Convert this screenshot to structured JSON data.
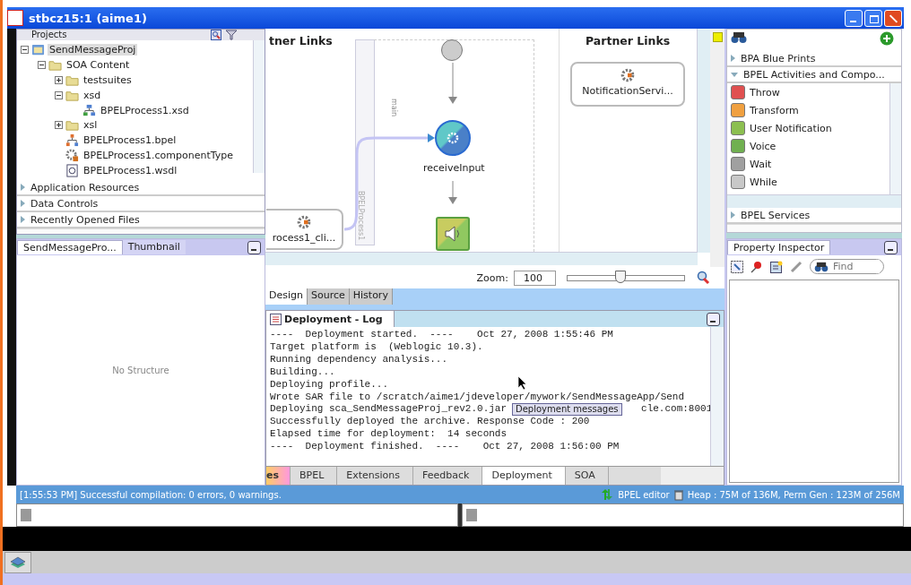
{
  "window": {
    "title": "stbcz15:1 (aime1)"
  },
  "projects": {
    "title": "Projects",
    "tree": [
      {
        "label": "SendMessageProj",
        "kind": "project",
        "selected": true,
        "expanded": true,
        "children": [
          {
            "label": "SOA Content",
            "kind": "folder",
            "selected": false,
            "expanded": true,
            "children": [
              {
                "label": "testsuites",
                "kind": "folder",
                "selected": false,
                "expanded": false
              },
              {
                "label": "xsd",
                "kind": "folder",
                "selected": false,
                "expanded": true,
                "children": [
                  {
                    "label": "BPELProcess1.xsd",
                    "kind": "schema",
                    "selected": false
                  }
                ]
              },
              {
                "label": "xsl",
                "kind": "folder",
                "selected": false,
                "expanded": false
              },
              {
                "label": "BPELProcess1.bpel",
                "kind": "bpel",
                "selected": false
              },
              {
                "label": "BPELProcess1.componentType",
                "kind": "component",
                "selected": false
              },
              {
                "label": "BPELProcess1.wsdl",
                "kind": "wsdl",
                "selected": false
              }
            ]
          }
        ]
      }
    ]
  },
  "navigator_sections": [
    {
      "label": "Application Resources",
      "expanded": false
    },
    {
      "label": "Data Controls",
      "expanded": false
    },
    {
      "label": "Recently Opened Files",
      "expanded": false
    }
  ],
  "structure": {
    "tabs": [
      {
        "label": "SendMessagePro...",
        "selected": true
      },
      {
        "label": "Thumbnail",
        "selected": false
      }
    ],
    "empty_text": "No Structure"
  },
  "canvas": {
    "left_heading": "tner Links",
    "right_heading": "Partner Links",
    "scope_label": "main",
    "process_label": "BPELProcess1",
    "left_partner": "rocess1_cli...",
    "right_partner": "NotificationServi...",
    "activities": [
      {
        "kind": "receive",
        "label": "receiveInput"
      },
      {
        "kind": "notification"
      }
    ]
  },
  "zoom": {
    "label": "Zoom:",
    "value": "100",
    "level": 0.45
  },
  "editor_tabs": [
    {
      "label": "Design",
      "selected": true
    },
    {
      "label": "Source",
      "selected": false
    },
    {
      "label": "History",
      "selected": false
    }
  ],
  "log": {
    "title": "Deployment - Log",
    "lines": [
      {
        "text": "----  Deployment started.  ----    Oct 27, 2008 1:55:46 PM"
      },
      {
        "text": "Target platform is  (Weblogic 10.3)."
      },
      {
        "text": "Running dependency analysis..."
      },
      {
        "text": "Building..."
      },
      {
        "text": "Deploying profile..."
      },
      {
        "text": "Wrote SAR file to /scratch/aime1/jdeveloper/mywork/SendMessageApp/Send"
      },
      {
        "text": "Deploying sca_SendMessageProj_rev2.0.jar",
        "tail": "cle.com:8001"
      },
      {
        "text": "Successfully deployed the archive. Response Code : 200"
      },
      {
        "text": "Elapsed time for deployment:  14 seconds"
      },
      {
        "text": "----  Deployment finished.  ----    Oct 27, 2008 1:56:00 PM"
      }
    ],
    "tooltip": "Deployment messages",
    "tabs": [
      {
        "label": "es",
        "selected": false
      },
      {
        "label": "BPEL",
        "selected": false
      },
      {
        "label": "Extensions",
        "selected": false
      },
      {
        "label": "Feedback",
        "selected": false
      },
      {
        "label": "Deployment",
        "selected": true
      },
      {
        "label": "SOA",
        "selected": false
      }
    ]
  },
  "palette": {
    "sections": [
      {
        "label": "BPA Blue Prints",
        "expanded": false
      },
      {
        "label": "BPEL Activities and Compo...",
        "expanded": true
      }
    ],
    "items": [
      {
        "kind": "throw",
        "label": "Throw"
      },
      {
        "kind": "transform",
        "label": "Transform"
      },
      {
        "kind": "notification",
        "label": "User Notification"
      },
      {
        "kind": "voice",
        "label": "Voice"
      },
      {
        "kind": "wait",
        "label": "Wait"
      },
      {
        "kind": "while",
        "label": "While"
      }
    ],
    "bottom_sections": [
      {
        "label": "BPEL Services",
        "expanded": false
      }
    ]
  },
  "property_inspector": {
    "title": "Property Inspector",
    "search": {
      "placeholder": "Find"
    }
  },
  "status_bar": {
    "message": "[1:55:53 PM] Successful compilation: 0 errors, 0 warnings.",
    "editor": "BPEL editor",
    "memory": "Heap : 75M of 136M, Perm Gen : 123M of 256M"
  }
}
